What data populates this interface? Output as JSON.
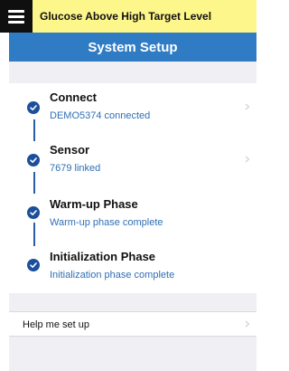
{
  "alert": {
    "text": "Glucose Above High Target Level"
  },
  "header": {
    "title": "System Setup"
  },
  "steps": [
    {
      "title": "Connect",
      "subtitle": "DEMO5374 connected"
    },
    {
      "title": "Sensor",
      "subtitle": "7679 linked"
    },
    {
      "title": "Warm-up Phase",
      "subtitle": "Warm-up phase complete"
    },
    {
      "title": "Initialization Phase",
      "subtitle": "Initialization phase complete"
    }
  ],
  "help": {
    "label": "Help me set up"
  },
  "colors": {
    "alert_bg": "#fdf68a",
    "title_bar": "#2f7cc5",
    "check_fill": "#1b4f9c",
    "subtitle_text": "#2f6fb5"
  }
}
